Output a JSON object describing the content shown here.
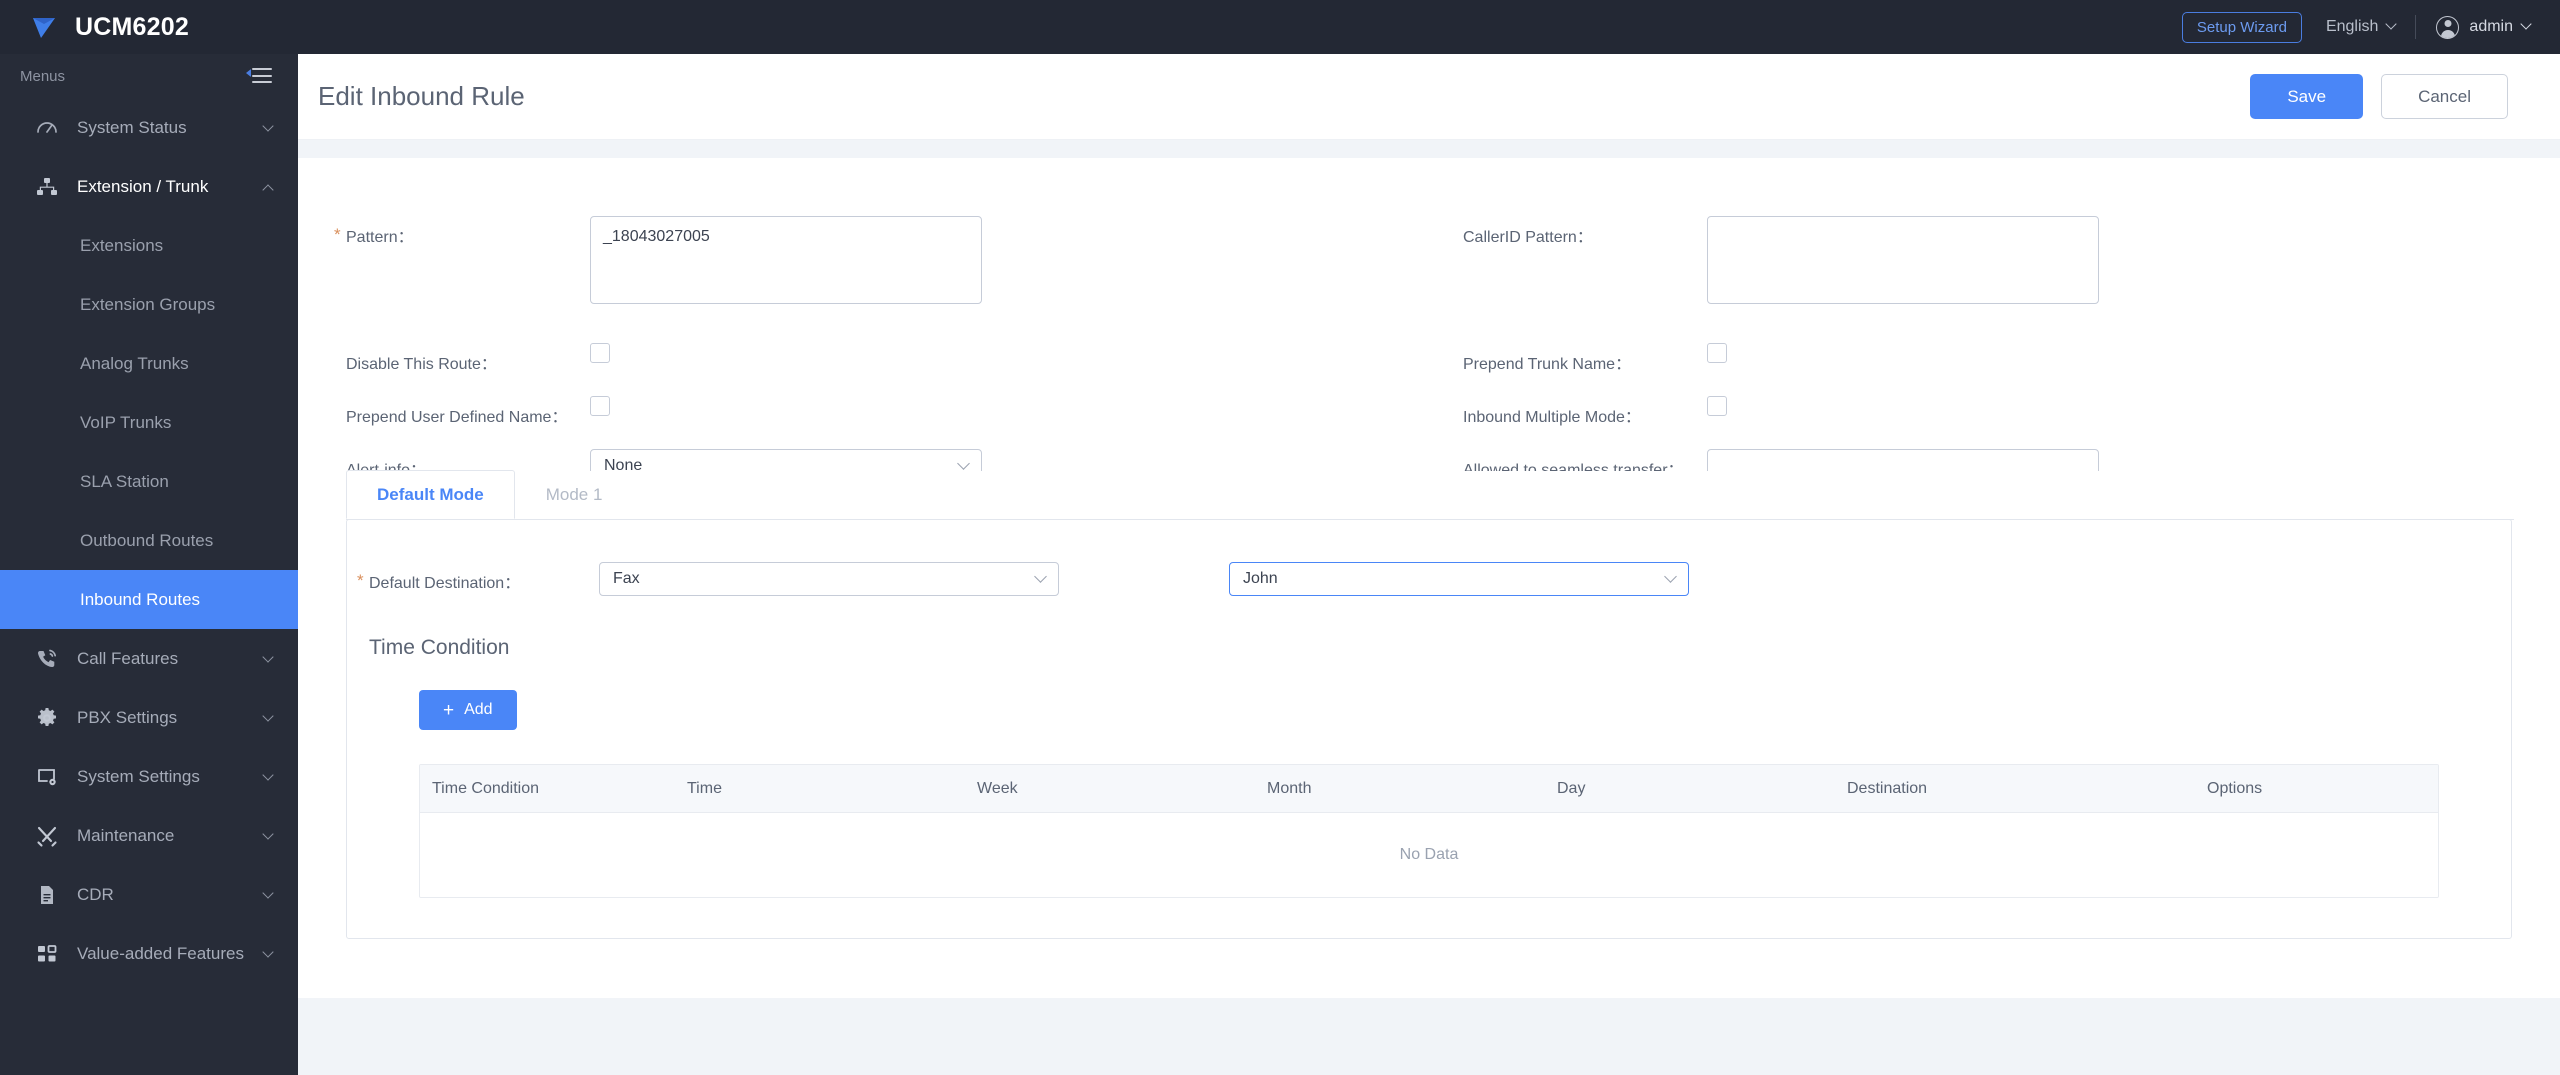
{
  "topbar": {
    "brand": "UCM6202",
    "logo_icon": "grandstream-logo-icon",
    "setup_wizard": "Setup Wizard",
    "language": "English",
    "user": "admin",
    "avatar_icon": "user-avatar-icon",
    "accent": "#4a86f7"
  },
  "sidebar": {
    "menus_label": "Menus",
    "collapse_icon": "collapse-menu-icon",
    "items": [
      {
        "label": "System Status",
        "icon": "dashboard-gauge-icon",
        "expanded": false
      },
      {
        "label": "Extension / Trunk",
        "icon": "sitemap-icon",
        "expanded": true
      },
      {
        "label": "Call Features",
        "icon": "phone-ring-icon",
        "expanded": false
      },
      {
        "label": "PBX Settings",
        "icon": "gear-icon",
        "expanded": false
      },
      {
        "label": "System Settings",
        "icon": "monitor-gear-icon",
        "expanded": false
      },
      {
        "label": "Maintenance",
        "icon": "tools-icon",
        "expanded": false
      },
      {
        "label": "CDR",
        "icon": "document-icon",
        "expanded": false
      },
      {
        "label": "Value-added Features",
        "icon": "grid-blocks-icon",
        "expanded": false
      }
    ],
    "extension_trunk_children": [
      {
        "label": "Extensions",
        "selected": false
      },
      {
        "label": "Extension Groups",
        "selected": false
      },
      {
        "label": "Analog Trunks",
        "selected": false
      },
      {
        "label": "VoIP Trunks",
        "selected": false
      },
      {
        "label": "SLA Station",
        "selected": false
      },
      {
        "label": "Outbound Routes",
        "selected": false
      },
      {
        "label": "Inbound Routes",
        "selected": true
      }
    ]
  },
  "page": {
    "title": "Edit Inbound Rule",
    "save_label": "Save",
    "cancel_label": "Cancel"
  },
  "form": {
    "pattern": {
      "label": "Pattern：",
      "value": "_18043027005",
      "required": true
    },
    "callerid_pattern": {
      "label": "CallerID Pattern：",
      "value": ""
    },
    "disable_route": {
      "label": "Disable This Route：",
      "checked": false
    },
    "prepend_trunk_name": {
      "label": "Prepend Trunk Name：",
      "checked": false
    },
    "prepend_user_defined_name": {
      "label": "Prepend User Defined Name：",
      "checked": false
    },
    "inbound_multiple_mode": {
      "label": "Inbound Multiple Mode：",
      "checked": false
    },
    "alert_info": {
      "label": "Alert-info：",
      "value": "None"
    },
    "allowed_seamless_transfer": {
      "label": "Allowed to seamless transfer：",
      "value": ""
    }
  },
  "modes": {
    "tabs": [
      {
        "label": "Default Mode",
        "active": true
      },
      {
        "label": "Mode 1",
        "active": false
      }
    ],
    "default_destination": {
      "label": "Default Destination：",
      "required": true,
      "type_value": "Fax",
      "target_value": "John",
      "target_focused": true
    },
    "time_condition": {
      "title": "Time Condition",
      "add_label": "Add",
      "add_icon": "plus-icon",
      "columns": [
        "Time Condition",
        "Time",
        "Week",
        "Month",
        "Day",
        "Destination",
        "Options"
      ],
      "rows": [],
      "empty_text": "No Data"
    }
  }
}
